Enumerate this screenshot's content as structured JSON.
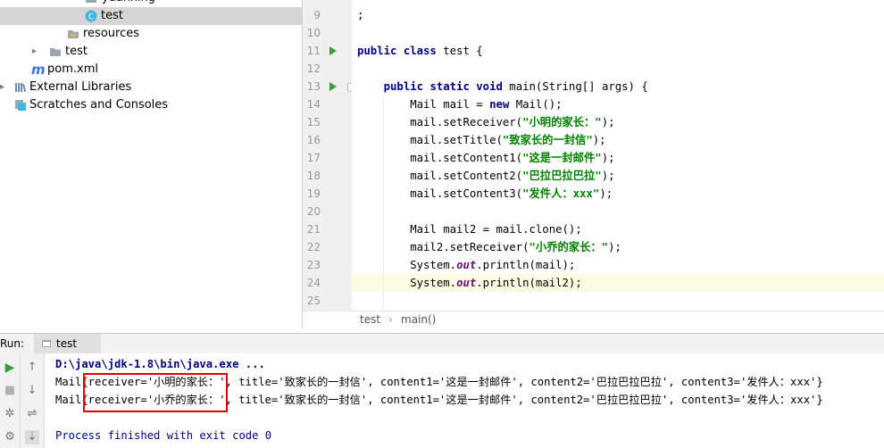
{
  "tree": {
    "items": [
      {
        "label": "yuanxing",
        "icon": "folder-icon"
      },
      {
        "label": "test",
        "icon": "class-icon"
      },
      {
        "label": "resources",
        "icon": "resources-folder-icon"
      },
      {
        "label": "test",
        "icon": "folder-icon"
      },
      {
        "label": "pom.xml",
        "icon": "maven-icon"
      },
      {
        "label": "External Libraries",
        "icon": "libraries-icon"
      },
      {
        "label": "Scratches and Consoles",
        "icon": "scratches-icon"
      }
    ]
  },
  "editor": {
    "lines": [
      {
        "n": "9",
        "text": ";"
      },
      {
        "n": "10",
        "text": ""
      },
      {
        "n": "11",
        "text": "public class test {"
      },
      {
        "n": "12",
        "text": ""
      },
      {
        "n": "13",
        "text": "    public static void main(String[] args) {"
      },
      {
        "n": "14",
        "text": "        Mail mail = new Mail();"
      },
      {
        "n": "15",
        "text": "        mail.setReceiver(\"小明的家长：\");"
      },
      {
        "n": "16",
        "text": "        mail.setTitle(\"致家长的一封信\");"
      },
      {
        "n": "17",
        "text": "        mail.setContent1(\"这是一封邮件\");"
      },
      {
        "n": "18",
        "text": "        mail.setContent2(\"巴拉巴拉巴拉\");"
      },
      {
        "n": "19",
        "text": "        mail.setContent3(\"发件人：xxx\");"
      },
      {
        "n": "20",
        "text": ""
      },
      {
        "n": "21",
        "text": "        Mail mail2 = mail.clone();"
      },
      {
        "n": "22",
        "text": "        mail2.setReceiver(\"小乔的家长：\");"
      },
      {
        "n": "23",
        "text": "        System.out.println(mail);"
      },
      {
        "n": "24",
        "text": "        System.out.println(mail2);"
      },
      {
        "n": "25",
        "text": ""
      }
    ],
    "current_line": "24"
  },
  "breadcrumb": {
    "items": [
      "test",
      "main()"
    ],
    "separator": "›"
  },
  "run": {
    "title": "Run:",
    "tab_label": "test",
    "console": {
      "command": "D:\\java\\jdk-1.8\\bin\\java.exe ...",
      "outputs": [
        "Mail{receiver='小明的家长：', title='致家长的一封信', content1='这是一封邮件', content2='巴拉巴拉巴拉', content3='发件人：xxx'}",
        "Mail{receiver='小乔的家长：', title='致家长的一封信', content1='这是一封邮件', content2='巴拉巴拉巴拉', content3='发件人：xxx'}"
      ],
      "exit_message": "Process finished with exit code 0"
    }
  },
  "colors": {
    "keyword": "#000080",
    "string": "#008000",
    "highlight_border": "#e00000",
    "selection": "#d5d5d5"
  }
}
